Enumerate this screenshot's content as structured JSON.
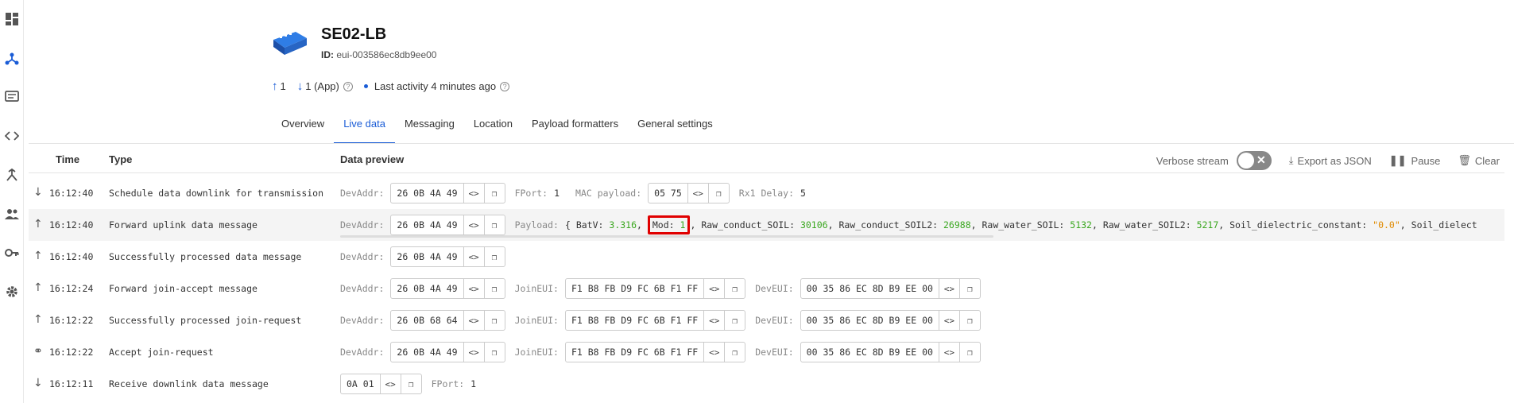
{
  "device": {
    "name": "SE02-LB",
    "id_label": "ID:",
    "id_value": "eui-003586ec8db9ee00"
  },
  "stats": {
    "uplink": "1",
    "downlink": "1 (App)",
    "activity": "Last activity 4 minutes ago"
  },
  "tabs": [
    "Overview",
    "Live data",
    "Messaging",
    "Location",
    "Payload formatters",
    "General settings"
  ],
  "table": {
    "headers": {
      "time": "Time",
      "type": "Type",
      "preview": "Data preview"
    },
    "controls": {
      "verbose": "Verbose stream",
      "export": "Export as JSON",
      "pause": "Pause",
      "clear": "Clear"
    }
  },
  "labels": {
    "devaddr": "DevAddr:",
    "fport": "FPort:",
    "mac_payload": "MAC payload:",
    "rx1_delay": "Rx1 Delay:",
    "payload": "Payload:",
    "joineui": "JoinEUI:",
    "deveui": "DevEUI:"
  },
  "rows": [
    {
      "time": "16:12:40",
      "type": "Schedule data downlink for transmission",
      "devaddr": "26 0B 4A 49",
      "fport": "1",
      "mac_payload": "05 75",
      "rx1_delay": "5"
    },
    {
      "time": "16:12:40",
      "type": "Forward uplink data message",
      "devaddr": "26 0B 4A 49",
      "payload": {
        "open": "{",
        "k1": "BatV:",
        "v1": "3.316",
        "k2": "Mod:",
        "v2": "1",
        "k3": "Raw_conduct_SOIL:",
        "v3": "30106",
        "k4": "Raw_conduct_SOIL2:",
        "v4": "26988",
        "k5": "Raw_water_SOIL:",
        "v5": "5132",
        "k6": "Raw_water_SOIL2:",
        "v6": "5217",
        "k7": "Soil_dielectric_constant:",
        "v7": "\"0.0\"",
        "k8": "Soil_dielect"
      }
    },
    {
      "time": "16:12:40",
      "type": "Successfully processed data message",
      "devaddr": "26 0B 4A 49"
    },
    {
      "time": "16:12:24",
      "type": "Forward join-accept message",
      "devaddr": "26 0B 4A 49",
      "joineui": "F1 B8 FB D9 FC 6B F1 FF",
      "deveui": "00 35 86 EC 8D B9 EE 00"
    },
    {
      "time": "16:12:22",
      "type": "Successfully processed join-request",
      "devaddr": "26 0B 68 64",
      "joineui": "F1 B8 FB D9 FC 6B F1 FF",
      "deveui": "00 35 86 EC 8D B9 EE 00"
    },
    {
      "time": "16:12:22",
      "type": "Accept join-request",
      "devaddr": "26 0B 4A 49",
      "joineui": "F1 B8 FB D9 FC 6B F1 FF",
      "deveui": "00 35 86 EC 8D B9 EE 00"
    },
    {
      "time": "16:12:11",
      "type": "Receive downlink data message",
      "data": "0A 01",
      "fport": "1"
    }
  ]
}
